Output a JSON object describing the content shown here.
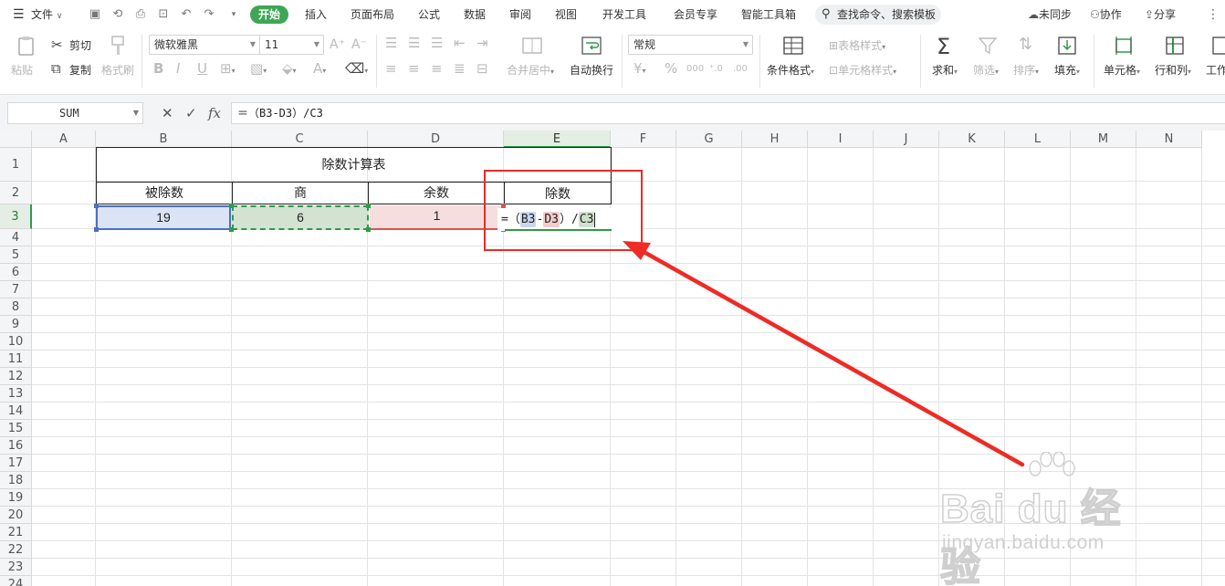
{
  "menubar": {
    "file_label": "文件",
    "tabs": [
      "开始",
      "插入",
      "页面布局",
      "公式",
      "数据",
      "审阅",
      "视图",
      "开发工具",
      "会员专享",
      "智能工具箱"
    ],
    "search_label": "查找命令、搜索模板",
    "sync_label": "未同步",
    "collab_label": "协作",
    "share_label": "分享"
  },
  "ribbon": {
    "paste": "粘贴",
    "cut": "剪切",
    "copy": "复制",
    "format_painter": "格式刷",
    "font_name": "微软雅黑",
    "font_size": "11",
    "merge_center": "合并居中",
    "wrap_text": "自动换行",
    "number_format": "常规",
    "conditional_format": "条件格式",
    "table_style": "表格样式",
    "cell_style": "单元格样式",
    "sum": "求和",
    "filter": "筛选",
    "sort": "排序",
    "fill": "填充",
    "cell": "单元格",
    "row_col": "行和列",
    "worksheet": "工作"
  },
  "formula_bar": {
    "name_box": "SUM",
    "formula": "＝（B3-D3）/C3"
  },
  "sheet": {
    "columns": [
      "A",
      "B",
      "C",
      "D",
      "E",
      "F",
      "G",
      "H",
      "I",
      "J",
      "K",
      "L",
      "M",
      "N"
    ],
    "rows": [
      "1",
      "2",
      "3",
      "4",
      "5",
      "6",
      "7",
      "8",
      "9",
      "10",
      "11",
      "12",
      "13",
      "14",
      "15",
      "16",
      "17",
      "18",
      "19",
      "20",
      "21",
      "22",
      "23",
      "24"
    ],
    "title": "除数计算表",
    "headers": [
      "被除数",
      "商",
      "余数",
      "除数"
    ],
    "values": [
      "19",
      "6",
      "1"
    ],
    "edit": {
      "eq": "=（",
      "ref1": "B3",
      "minus": "-",
      "ref2": "D3",
      "mid": "）/",
      "ref3": "C3"
    }
  },
  "watermark": {
    "url": "jingyan.baidu.com"
  },
  "colors": {
    "accent_green": "#3ea655",
    "ref_blue": "#4a6fc4",
    "ref_green": "#2e9a4a",
    "ref_red": "#d9534f",
    "annotation_red": "#ee2b25"
  }
}
